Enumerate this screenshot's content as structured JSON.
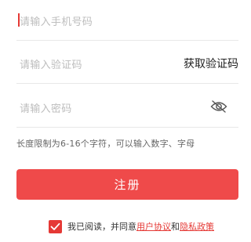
{
  "form": {
    "phone": {
      "placeholder": "请输入手机号码"
    },
    "code": {
      "placeholder": "请输入验证码",
      "get_code_label": "获取验证码"
    },
    "password": {
      "placeholder": "请输入密码",
      "toggle_icon": "eye-slash-icon"
    },
    "hint": "长度限制为6-16个字符，可以输入数字、字母",
    "submit_label": "注册"
  },
  "agreement": {
    "checked": true,
    "prefix": "我已阅读，并同意",
    "user_agreement": "用户协议",
    "and": "和",
    "privacy_policy": "隐私政策"
  },
  "colors": {
    "accent": "#ef4a4a",
    "text": "#222222",
    "placeholder": "#bdbdbd"
  }
}
